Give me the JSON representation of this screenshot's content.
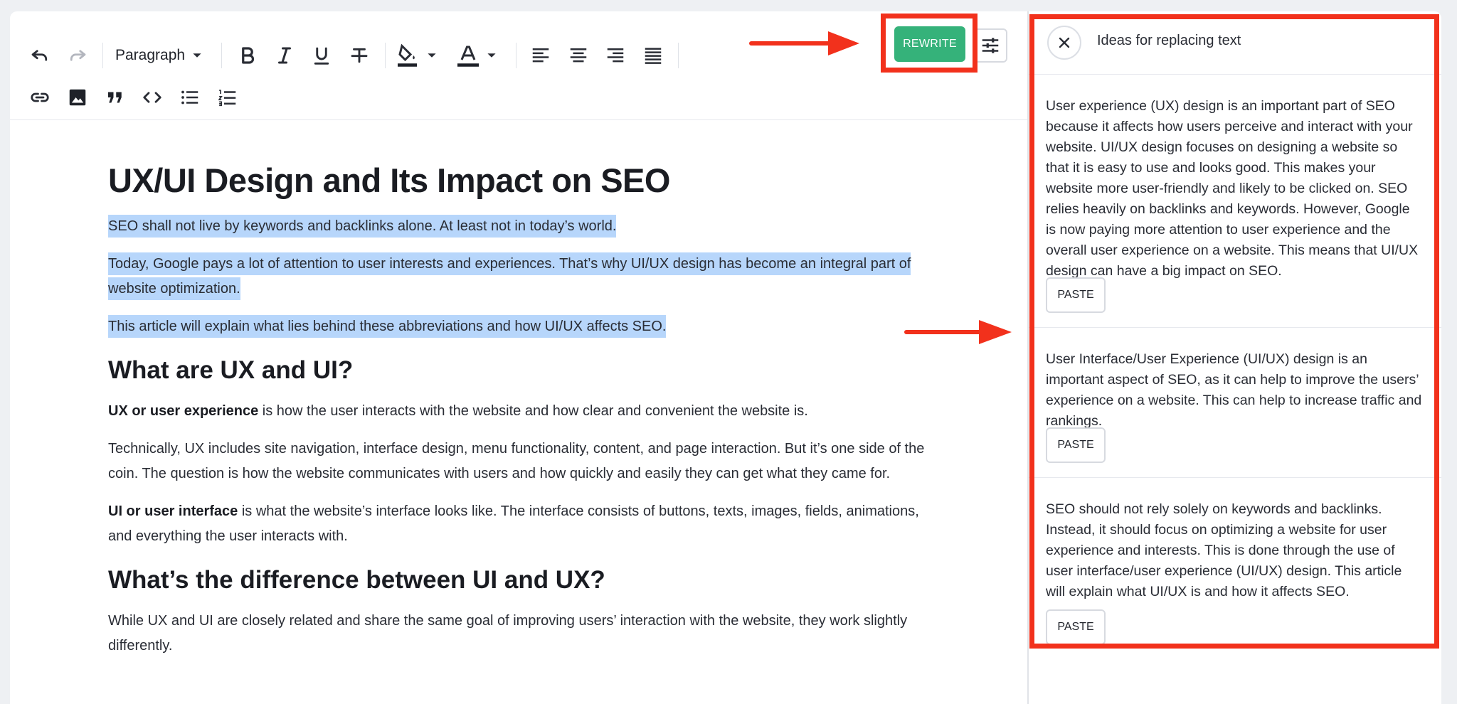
{
  "toolbar": {
    "undo": "undo-icon",
    "redo": "redo-icon",
    "block_format": "Paragraph",
    "rewrite_label": "REWRITE",
    "settings": "sliders-icon"
  },
  "document": {
    "title": "UX/UI Design and Its Impact on SEO",
    "intro": [
      "SEO shall not live by keywords and backlinks alone. At least not in today’s world.",
      "Today, Google pays a lot of attention to user interests and experiences. That’s why UI/UX design has become an integral part of website optimization.",
      "This article will explain what lies behind these abbreviations and how UI/UX affects SEO."
    ],
    "h2_1": "What are UX and UI?",
    "ux_term": "UX or user experience",
    "ux_def": " is how the user interacts with the website and how clear and convenient the website is.",
    "ux_tech": "Technically, UX includes site navigation, interface design, menu functionality, content, and page interaction. But it’s one side of the coin. The question is how the website communicates with users and how quickly and easily they can get what they came for.",
    "ui_term": "UI or user interface",
    "ui_def": " is what the website’s interface looks like. The interface consists of buttons, texts, images, fields, animations, and everything the user interacts with.",
    "h2_2": "What’s the difference between UI and UX?",
    "diff": "While UX and UI are closely related and share the same goal of improving users’ interaction with the website, they work slightly differently."
  },
  "panel": {
    "title": "Ideas for replacing text",
    "ideas": [
      {
        "text": "User experience (UX) design is an important part of SEO because it affects how users perceive and interact with your website. UI/UX design focuses on designing a website so that it is easy to use and looks good. This makes your website more user-friendly and likely to be clicked on. SEO relies heavily on backlinks and keywords. However, Google is now paying more attention to user experience and the overall user experience on a website. This means that UI/UX design can have a big impact on SEO.",
        "button": "PASTE"
      },
      {
        "text": "User Interface/User Experience (UI/UX) design is an important aspect of SEO, as it can help to improve the users’ experience on a website. This can help to increase traffic and rankings.",
        "button": "PASTE"
      },
      {
        "text": "SEO should not rely solely on keywords and backlinks. Instead, it should focus on optimizing a website for user experience and interests. This is done through the use of user interface/user experience (UI/UX) design. This article will explain what UI/UX is and how it affects SEO.",
        "button": "PASTE"
      }
    ]
  },
  "colors": {
    "accent": "#35b27a",
    "highlight": "#b7d6fb",
    "annotation": "#f2311c"
  }
}
